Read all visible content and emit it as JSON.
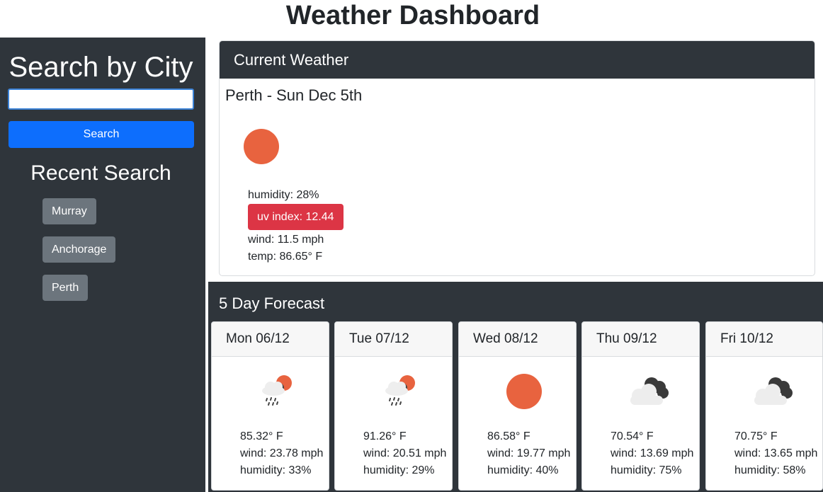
{
  "page": {
    "title": "Weather Dashboard"
  },
  "sidebar": {
    "title": "Search by City",
    "search": {
      "value": "",
      "placeholder": ""
    },
    "search_label": "Search",
    "recent_title": "Recent Search",
    "recent": [
      "Murray",
      "Anchorage",
      "Perth"
    ]
  },
  "current": {
    "header": "Current Weather",
    "city_date": "Perth - Sun Dec 5th",
    "icon": "sun-icon",
    "humidity": "humidity: 28%",
    "uv": "uv index: 12.44",
    "wind": "wind: 11.5 mph",
    "temp": "temp: 86.65° F"
  },
  "forecast": {
    "title": "5 Day Forecast",
    "days": [
      {
        "date": "Mon 06/12",
        "icon": "rain-sun-icon",
        "temp": "85.32° F",
        "wind": "wind: 23.78 mph",
        "humidity": "humidity: 33%"
      },
      {
        "date": "Tue 07/12",
        "icon": "rain-sun-icon",
        "temp": "91.26° F",
        "wind": "wind: 20.51 mph",
        "humidity": "humidity: 29%"
      },
      {
        "date": "Wed 08/12",
        "icon": "sun-icon",
        "temp": "86.58° F",
        "wind": "wind: 19.77 mph",
        "humidity": "humidity: 40%"
      },
      {
        "date": "Thu 09/12",
        "icon": "cloud-icon",
        "temp": "70.54° F",
        "wind": "wind: 13.69 mph",
        "humidity": "humidity: 75%"
      },
      {
        "date": "Fri 10/12",
        "icon": "cloud-icon",
        "temp": "70.75° F",
        "wind": "wind: 13.65 mph",
        "humidity": "humidity: 58%"
      }
    ]
  },
  "colors": {
    "sidebar": "#2f353b",
    "primary": "#0d6efd",
    "danger": "#dc3545",
    "secondary": "#6c757d",
    "sun": "#e8633f"
  }
}
